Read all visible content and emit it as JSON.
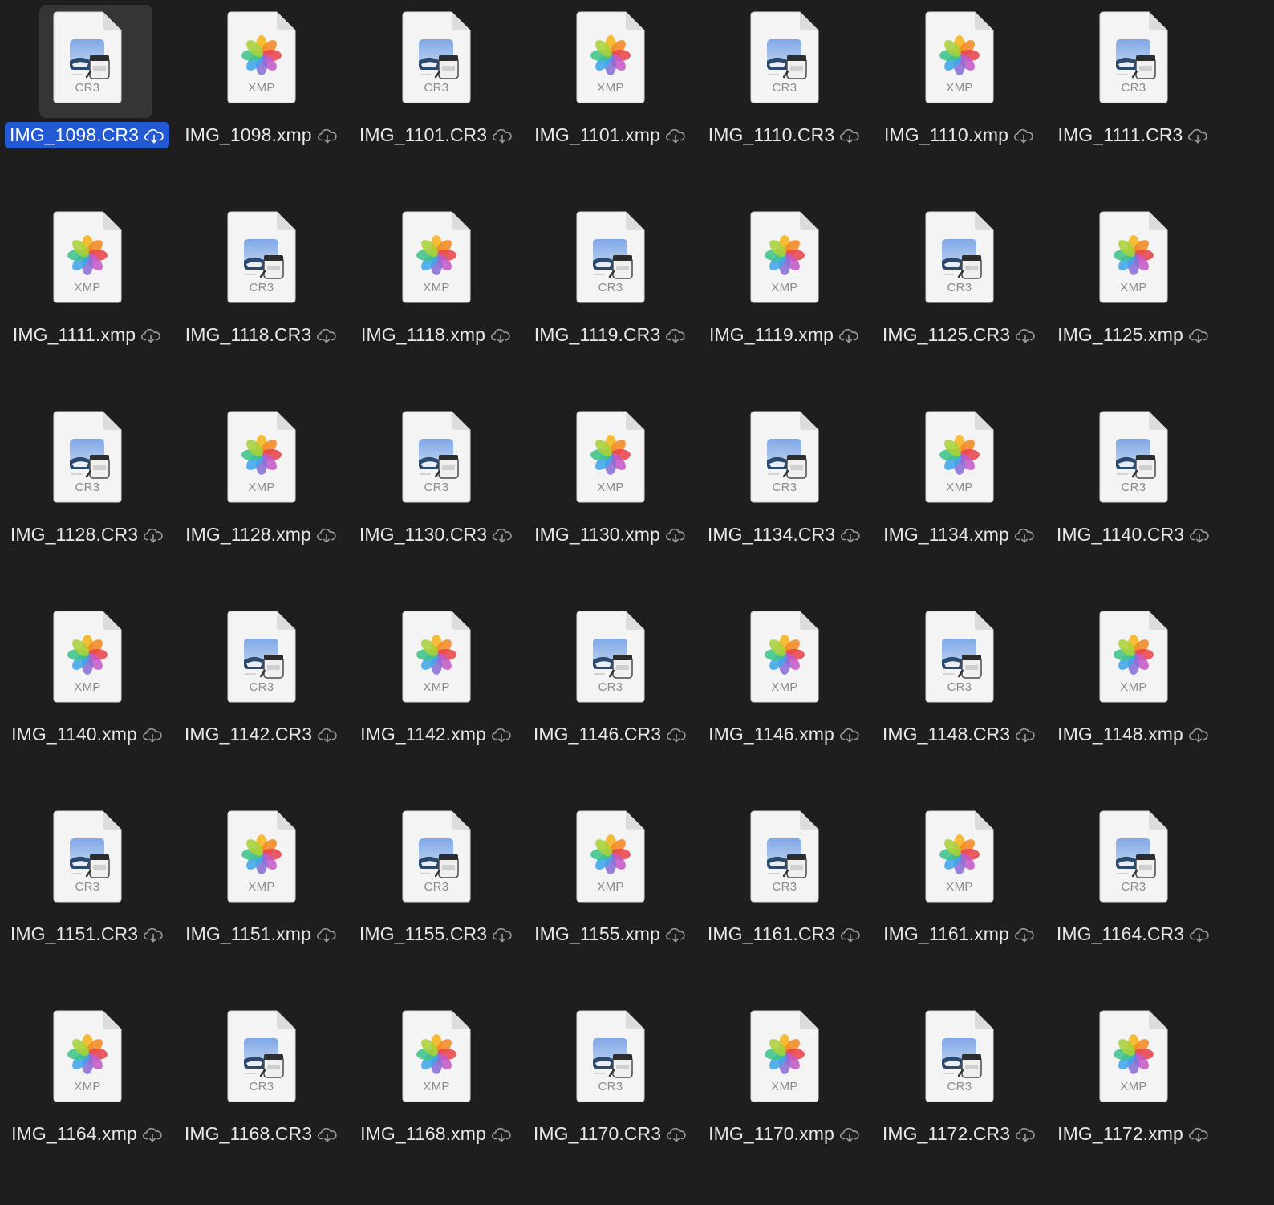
{
  "window": {
    "view": "Finder icon view",
    "background": "#1e1e1e",
    "selection_color": "#2359d2"
  },
  "icons": {
    "CR3": "raw-image-document-icon",
    "xmp": "photos-document-icon",
    "status": "icloud-download-icon"
  },
  "files": [
    {
      "name": "IMG_1098.CR3",
      "type": "CR3",
      "ext_label": "CR3",
      "selected": true
    },
    {
      "name": "IMG_1098.xmp",
      "type": "xmp",
      "ext_label": "XMP",
      "selected": false
    },
    {
      "name": "IMG_1101.CR3",
      "type": "CR3",
      "ext_label": "CR3",
      "selected": false
    },
    {
      "name": "IMG_1101.xmp",
      "type": "xmp",
      "ext_label": "XMP",
      "selected": false
    },
    {
      "name": "IMG_1110.CR3",
      "type": "CR3",
      "ext_label": "CR3",
      "selected": false
    },
    {
      "name": "IMG_1110.xmp",
      "type": "xmp",
      "ext_label": "XMP",
      "selected": false
    },
    {
      "name": "IMG_1111.CR3",
      "type": "CR3",
      "ext_label": "CR3",
      "selected": false
    },
    {
      "name": "IMG_1111.xmp",
      "type": "xmp",
      "ext_label": "XMP",
      "selected": false
    },
    {
      "name": "IMG_1118.CR3",
      "type": "CR3",
      "ext_label": "CR3",
      "selected": false
    },
    {
      "name": "IMG_1118.xmp",
      "type": "xmp",
      "ext_label": "XMP",
      "selected": false
    },
    {
      "name": "IMG_1119.CR3",
      "type": "CR3",
      "ext_label": "CR3",
      "selected": false
    },
    {
      "name": "IMG_1119.xmp",
      "type": "xmp",
      "ext_label": "XMP",
      "selected": false
    },
    {
      "name": "IMG_1125.CR3",
      "type": "CR3",
      "ext_label": "CR3",
      "selected": false
    },
    {
      "name": "IMG_1125.xmp",
      "type": "xmp",
      "ext_label": "XMP",
      "selected": false
    },
    {
      "name": "IMG_1128.CR3",
      "type": "CR3",
      "ext_label": "CR3",
      "selected": false
    },
    {
      "name": "IMG_1128.xmp",
      "type": "xmp",
      "ext_label": "XMP",
      "selected": false
    },
    {
      "name": "IMG_1130.CR3",
      "type": "CR3",
      "ext_label": "CR3",
      "selected": false
    },
    {
      "name": "IMG_1130.xmp",
      "type": "xmp",
      "ext_label": "XMP",
      "selected": false
    },
    {
      "name": "IMG_1134.CR3",
      "type": "CR3",
      "ext_label": "CR3",
      "selected": false
    },
    {
      "name": "IMG_1134.xmp",
      "type": "xmp",
      "ext_label": "XMP",
      "selected": false
    },
    {
      "name": "IMG_1140.CR3",
      "type": "CR3",
      "ext_label": "CR3",
      "selected": false
    },
    {
      "name": "IMG_1140.xmp",
      "type": "xmp",
      "ext_label": "XMP",
      "selected": false
    },
    {
      "name": "IMG_1142.CR3",
      "type": "CR3",
      "ext_label": "CR3",
      "selected": false
    },
    {
      "name": "IMG_1142.xmp",
      "type": "xmp",
      "ext_label": "XMP",
      "selected": false
    },
    {
      "name": "IMG_1146.CR3",
      "type": "CR3",
      "ext_label": "CR3",
      "selected": false
    },
    {
      "name": "IMG_1146.xmp",
      "type": "xmp",
      "ext_label": "XMP",
      "selected": false
    },
    {
      "name": "IMG_1148.CR3",
      "type": "CR3",
      "ext_label": "CR3",
      "selected": false
    },
    {
      "name": "IMG_1148.xmp",
      "type": "xmp",
      "ext_label": "XMP",
      "selected": false
    },
    {
      "name": "IMG_1151.CR3",
      "type": "CR3",
      "ext_label": "CR3",
      "selected": false
    },
    {
      "name": "IMG_1151.xmp",
      "type": "xmp",
      "ext_label": "XMP",
      "selected": false
    },
    {
      "name": "IMG_1155.CR3",
      "type": "CR3",
      "ext_label": "CR3",
      "selected": false
    },
    {
      "name": "IMG_1155.xmp",
      "type": "xmp",
      "ext_label": "XMP",
      "selected": false
    },
    {
      "name": "IMG_1161.CR3",
      "type": "CR3",
      "ext_label": "CR3",
      "selected": false
    },
    {
      "name": "IMG_1161.xmp",
      "type": "xmp",
      "ext_label": "XMP",
      "selected": false
    },
    {
      "name": "IMG_1164.CR3",
      "type": "CR3",
      "ext_label": "CR3",
      "selected": false
    },
    {
      "name": "IMG_1164.xmp",
      "type": "xmp",
      "ext_label": "XMP",
      "selected": false
    },
    {
      "name": "IMG_1168.CR3",
      "type": "CR3",
      "ext_label": "CR3",
      "selected": false
    },
    {
      "name": "IMG_1168.xmp",
      "type": "xmp",
      "ext_label": "XMP",
      "selected": false
    },
    {
      "name": "IMG_1170.CR3",
      "type": "CR3",
      "ext_label": "CR3",
      "selected": false
    },
    {
      "name": "IMG_1170.xmp",
      "type": "xmp",
      "ext_label": "XMP",
      "selected": false
    },
    {
      "name": "IMG_1172.CR3",
      "type": "CR3",
      "ext_label": "CR3",
      "selected": false
    },
    {
      "name": "IMG_1172.xmp",
      "type": "xmp",
      "ext_label": "XMP",
      "selected": false
    }
  ]
}
